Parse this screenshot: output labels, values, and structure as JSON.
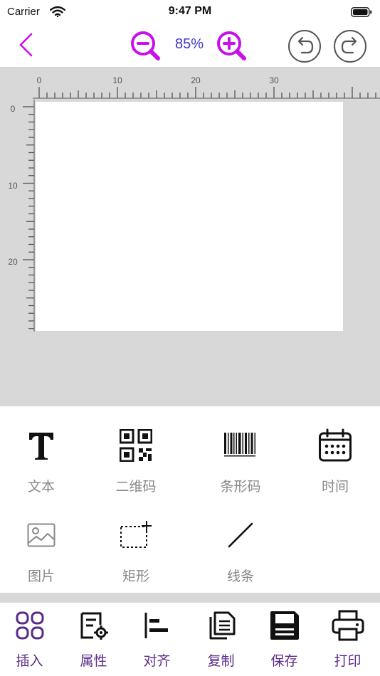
{
  "status_bar": {
    "carrier": "Carrier",
    "time": "9:47 PM"
  },
  "toolbar": {
    "zoom_level": "85%",
    "accent_color": "#c711e8",
    "zoom_text_color": "#3d35c9"
  },
  "ruler": {
    "horizontal_labels": [
      "0",
      "10",
      "20",
      "30"
    ],
    "vertical_labels": [
      "0",
      "10",
      "20"
    ]
  },
  "tools": [
    {
      "label": "文本",
      "icon": "text-icon"
    },
    {
      "label": "二维码",
      "icon": "qr-code-icon"
    },
    {
      "label": "条形码",
      "icon": "barcode-icon"
    },
    {
      "label": "时间",
      "icon": "calendar-icon"
    },
    {
      "label": "图片",
      "icon": "image-icon"
    },
    {
      "label": "矩形",
      "icon": "rectangle-icon"
    },
    {
      "label": "线条",
      "icon": "line-icon"
    }
  ],
  "tab_bar": {
    "tabs": [
      {
        "label": "插入",
        "icon": "grid-icon"
      },
      {
        "label": "属性",
        "icon": "properties-icon"
      },
      {
        "label": "对齐",
        "icon": "align-left-icon"
      },
      {
        "label": "复制",
        "icon": "copy-icon"
      },
      {
        "label": "保存",
        "icon": "save-icon"
      },
      {
        "label": "打印",
        "icon": "printer-icon"
      }
    ],
    "label_color": "#5a2a88"
  }
}
